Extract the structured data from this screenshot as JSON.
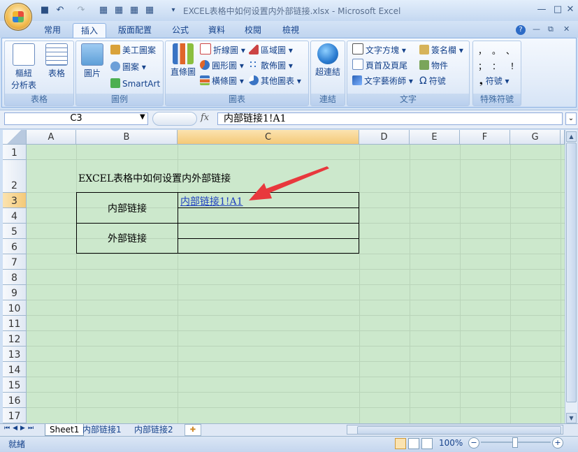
{
  "window": {
    "title": "EXCEL表格中如何设置内外部链接.xlsx - Microsoft Excel",
    "minimize": "—",
    "maximize": "□",
    "close": "✕"
  },
  "tabs": [
    "常用",
    "插入",
    "版面配置",
    "公式",
    "資料",
    "校閱",
    "檢視"
  ],
  "active_tab": "插入",
  "ribbon": {
    "groups": {
      "table": "表格",
      "illustration": "圖例",
      "chart": "圖表",
      "link": "連結",
      "text": "文字",
      "symbol": "特殊符號"
    },
    "buttons": {
      "pivot": "樞紐",
      "pivot2": "分析表",
      "table": "表格",
      "picture": "圖片",
      "clipart": "美工圖案",
      "shapes": "圖案",
      "smartart": "SmartArt",
      "column": "直條圖",
      "line": "折線圖",
      "pie": "圓形圖",
      "bar": "橫條圖",
      "area": "區域圖",
      "scatter": "散佈圖",
      "other": "其他圖表",
      "hyperlink": "超連結",
      "textbox": "文字方塊",
      "header": "頁首及頁尾",
      "wordart": "文字藝術師",
      "signature": "簽名欄",
      "object": "物件",
      "symbol": "符號",
      "symbol2": "符號"
    }
  },
  "formula_bar": {
    "name_box": "C3",
    "fx": "fx",
    "formula": "内部链接1!A1"
  },
  "grid": {
    "columns": [
      "A",
      "B",
      "C",
      "D",
      "E",
      "F",
      "G"
    ],
    "rows": [
      "1",
      "2",
      "3",
      "4",
      "5",
      "6",
      "7",
      "8",
      "9",
      "10",
      "11",
      "12",
      "13",
      "14",
      "15",
      "16",
      "17"
    ],
    "cells": {
      "B2": "EXCEL表格中如何设置内外部链接",
      "B3": "内部链接",
      "C3": "内部链接1!A1",
      "B5": "外部链接"
    }
  },
  "sheets": [
    "Sheet1",
    "内部链接1",
    "内部链接2"
  ],
  "active_sheet": "Sheet1",
  "status": {
    "ready": "就緒",
    "zoom": "100%"
  },
  "colors": {
    "grid_bg": "#cce8cc",
    "link": "#1f3fbf",
    "arrow": "#e8383d"
  }
}
